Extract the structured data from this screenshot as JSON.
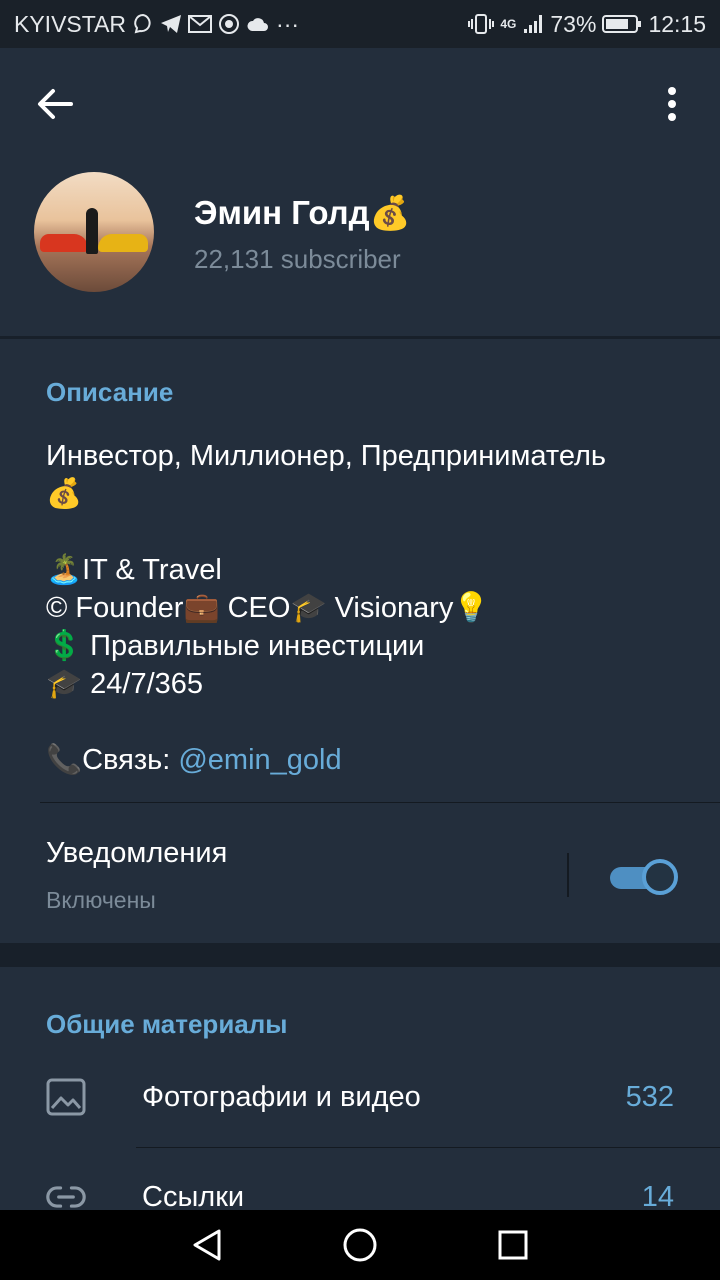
{
  "status_bar": {
    "carrier": "KYIVSTAR",
    "network": "4G",
    "battery": "73%",
    "time": "12:15",
    "more": "···"
  },
  "profile": {
    "name": "Эмин Голд💰",
    "subscribers": "22,131 subscriber"
  },
  "info": {
    "description_title": "Описание",
    "description_lines": [
      "Инвестор, Миллионер, Предприниматель",
      "💰",
      "",
      "🏝️IT & Travel",
      "© Founder💼 CEO🎓 Visionary💡",
      "💲 Правильные инвестиции",
      "🎓 24/7/365",
      ""
    ],
    "contact_prefix": "📞Связь: ",
    "contact_link": "@emin_gold",
    "notifications_label": "Уведомления",
    "notifications_status": "Включены",
    "notifications_on": true
  },
  "shared_media": {
    "title": "Общие материалы",
    "items": [
      {
        "label": "Фотографии и видео",
        "count": "532",
        "icon": "photo-icon"
      },
      {
        "label": "Ссылки",
        "count": "14",
        "icon": "link-icon"
      }
    ]
  },
  "colors": {
    "background": "#1d2733",
    "card": "#232e3c",
    "accent": "#68acd9",
    "secondary_text": "#7c8b99"
  }
}
